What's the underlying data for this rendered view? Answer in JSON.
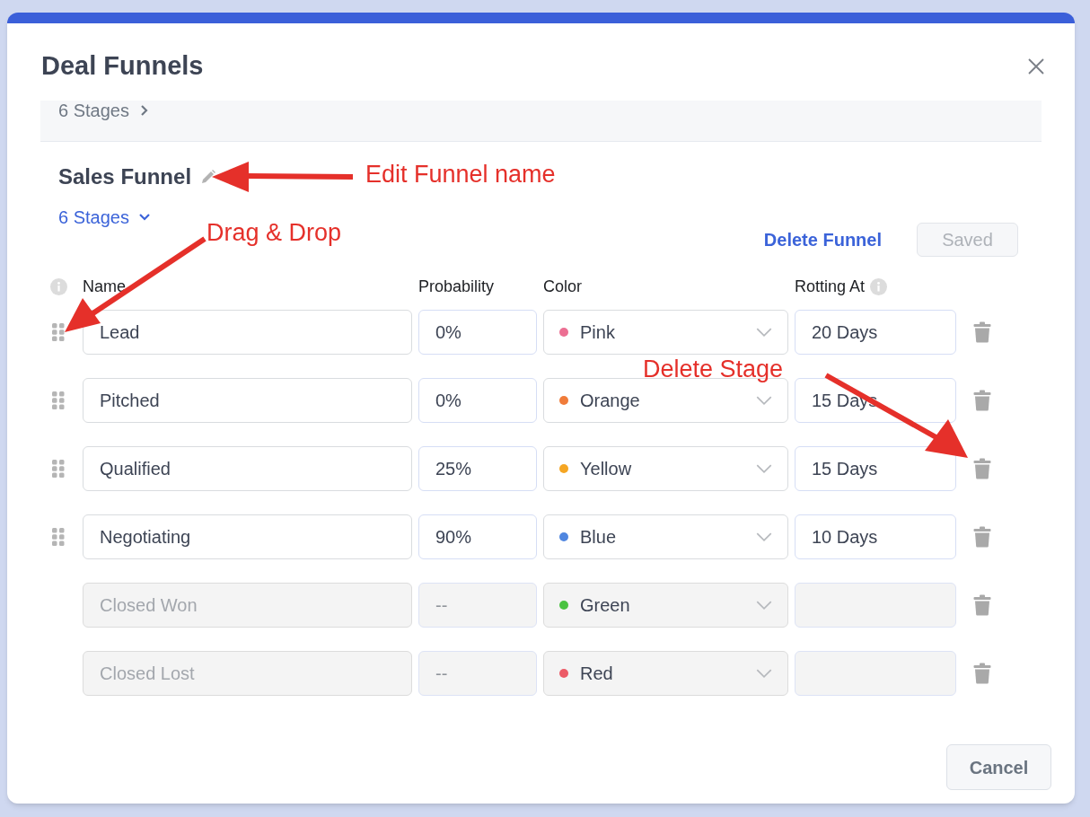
{
  "dialog": {
    "title": "Deal Funnels"
  },
  "collapsed_funnel": {
    "stages_label": "6 Stages",
    "expanded": false
  },
  "funnel": {
    "name": "Sales Funnel",
    "stages_label": "6 Stages",
    "expanded": true,
    "actions": {
      "delete_link": "Delete Funnel",
      "save_button": {
        "label": "Saved",
        "disabled": true
      }
    },
    "columns": [
      "Name",
      "Probability",
      "Color",
      "Rotting At"
    ],
    "stages": [
      {
        "name": "Lead",
        "probability": "0%",
        "color_name": "Pink",
        "color": "#ec6f93",
        "rotting": "20 Days",
        "draggable": true,
        "disabled": false
      },
      {
        "name": "Pitched",
        "probability": "0%",
        "color_name": "Orange",
        "color": "#f07c3a",
        "rotting": "15 Days",
        "draggable": true,
        "disabled": false
      },
      {
        "name": "Qualified",
        "probability": "25%",
        "color_name": "Yellow",
        "color": "#f5a623",
        "rotting": "15 Days",
        "draggable": true,
        "disabled": false
      },
      {
        "name": "Negotiating",
        "probability": "90%",
        "color_name": "Blue",
        "color": "#4f86e0",
        "rotting": "10 Days",
        "draggable": true,
        "disabled": false
      },
      {
        "name": "Closed Won",
        "probability": "--",
        "color_name": "Green",
        "color": "#4ac341",
        "draggable": false,
        "disabled": true
      },
      {
        "name": "Closed Lost",
        "probability": "--",
        "color_name": "Red",
        "color": "#ec5b67",
        "draggable": false,
        "disabled": true
      }
    ]
  },
  "footer": {
    "cancel_button": "Cancel"
  },
  "annotations": [
    {
      "text": "Edit Funnel name"
    },
    {
      "text": "Drag & Drop"
    },
    {
      "text": "Delete Stage"
    }
  ]
}
